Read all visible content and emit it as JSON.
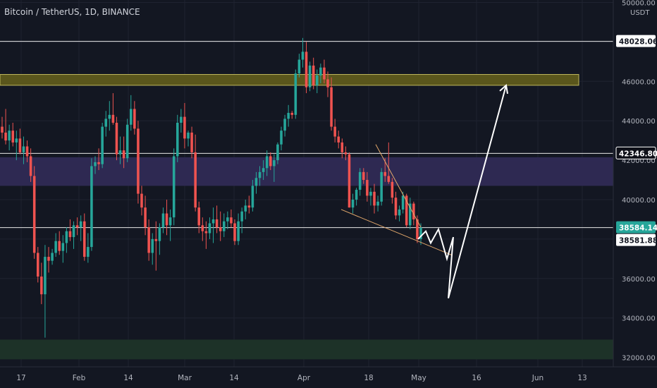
{
  "header": {
    "title": "Bitcoin / TetherUS, 1D, BINANCE",
    "currency": "USDT"
  },
  "chart_data": {
    "type": "candlestick",
    "title": "Bitcoin / TetherUS, 1D, BINANCE",
    "y_ticks": [
      "50000.00",
      "46000.00",
      "44000.00",
      "42000.00",
      "40000.00",
      "36000.00",
      "34000.00",
      "32000.00"
    ],
    "x_ticks": [
      "17",
      "Feb",
      "14",
      "Mar",
      "14",
      "Apr",
      "18",
      "May",
      "16",
      "Jun",
      "13"
    ],
    "ylim": [
      31500,
      50200
    ],
    "price_labels": [
      {
        "text": "48028.06",
        "value": 48028.06,
        "style": "line"
      },
      {
        "text": "42346.80",
        "value": 42346.8,
        "style": "dark"
      },
      {
        "text": "38584.14",
        "value": 38584.14,
        "style": "green"
      },
      {
        "text": "38581.88",
        "value": 38581.88,
        "style": "line"
      }
    ],
    "horizontal_lines": [
      48028.06,
      42346.8,
      38584.14
    ],
    "zones": [
      {
        "name": "resistance",
        "from": 45800,
        "to": 46350,
        "color": "#5e5a1c"
      },
      {
        "name": "range",
        "from": 40700,
        "to": 42150,
        "color": "#2f2a55"
      },
      {
        "name": "support",
        "from": 31900,
        "to": 32900,
        "color": "#1e3429"
      }
    ],
    "colors": {
      "up": "#26a69a",
      "down": "#ef5350",
      "background": "#131722",
      "grid": "#1f2330"
    },
    "candles_note": "OHLC values estimated from the visible candles",
    "candles": [
      [
        43700,
        44200,
        43100,
        43400
      ],
      [
        43400,
        44600,
        42800,
        43000
      ],
      [
        43000,
        43800,
        42500,
        43500
      ],
      [
        43500,
        43900,
        42700,
        42900
      ],
      [
        42900,
        43500,
        42000,
        43100
      ],
      [
        43100,
        43600,
        42300,
        42400
      ],
      [
        42400,
        43200,
        41800,
        42700
      ],
      [
        42700,
        43000,
        41900,
        42200
      ],
      [
        42200,
        42600,
        40900,
        41200
      ],
      [
        41200,
        41700,
        37000,
        37300
      ],
      [
        37300,
        37600,
        35800,
        36100
      ],
      [
        36100,
        36800,
        34700,
        35200
      ],
      [
        35200,
        37700,
        33000,
        37100
      ],
      [
        37100,
        37600,
        36300,
        36900
      ],
      [
        36900,
        37500,
        36700,
        37300
      ],
      [
        37300,
        38300,
        37100,
        37900
      ],
      [
        37900,
        38400,
        37200,
        37400
      ],
      [
        37400,
        38200,
        36800,
        37800
      ],
      [
        37800,
        38600,
        37300,
        38400
      ],
      [
        38400,
        39000,
        37900,
        38100
      ],
      [
        38100,
        38900,
        37500,
        38700
      ],
      [
        38700,
        39100,
        38200,
        38600
      ],
      [
        38600,
        39200,
        37900,
        38900
      ],
      [
        38900,
        39300,
        36900,
        37100
      ],
      [
        37100,
        38300,
        36800,
        37600
      ],
      [
        37600,
        42100,
        37400,
        41700
      ],
      [
        41700,
        42200,
        41300,
        41900
      ],
      [
        41900,
        42600,
        41500,
        41800
      ],
      [
        41800,
        43900,
        41600,
        43700
      ],
      [
        43700,
        44500,
        43200,
        44100
      ],
      [
        44100,
        45000,
        43500,
        44300
      ],
      [
        44300,
        45400,
        43800,
        43900
      ],
      [
        43900,
        44200,
        42000,
        42300
      ],
      [
        42300,
        43200,
        41800,
        42500
      ],
      [
        42500,
        43200,
        41600,
        42100
      ],
      [
        42100,
        44100,
        41900,
        43800
      ],
      [
        43800,
        45300,
        43500,
        44600
      ],
      [
        44600,
        45000,
        43300,
        43600
      ],
      [
        43600,
        44000,
        39800,
        40300
      ],
      [
        40300,
        40700,
        39200,
        39600
      ],
      [
        39600,
        40200,
        38200,
        38600
      ],
      [
        38600,
        39000,
        36900,
        37300
      ],
      [
        37300,
        38300,
        36700,
        38000
      ],
      [
        38000,
        38900,
        36400,
        37900
      ],
      [
        37900,
        38800,
        37200,
        38600
      ],
      [
        38600,
        39600,
        38300,
        39300
      ],
      [
        39300,
        40000,
        38200,
        38700
      ],
      [
        38700,
        39500,
        37900,
        39100
      ],
      [
        39100,
        42600,
        38700,
        42200
      ],
      [
        42200,
        44300,
        41900,
        43900
      ],
      [
        43900,
        44600,
        43400,
        44200
      ],
      [
        44200,
        44900,
        42600,
        43100
      ],
      [
        43100,
        43500,
        42700,
        43400
      ],
      [
        43400,
        43700,
        42100,
        42400
      ],
      [
        42400,
        43300,
        39400,
        39600
      ],
      [
        39600,
        39900,
        38300,
        38700
      ],
      [
        38700,
        39100,
        37900,
        38400
      ],
      [
        38400,
        38900,
        37500,
        38300
      ],
      [
        38300,
        39100,
        38000,
        38800
      ],
      [
        38800,
        39600,
        37800,
        39000
      ],
      [
        39000,
        39700,
        38300,
        38600
      ],
      [
        38600,
        39400,
        37900,
        38400
      ],
      [
        38400,
        39300,
        38100,
        38900
      ],
      [
        38900,
        39400,
        38500,
        39100
      ],
      [
        39100,
        39500,
        38600,
        38800
      ],
      [
        38800,
        39000,
        37700,
        37900
      ],
      [
        37900,
        39300,
        37700,
        38900
      ],
      [
        38900,
        39600,
        38300,
        39400
      ],
      [
        39400,
        40000,
        39000,
        39700
      ],
      [
        39700,
        40200,
        39300,
        39600
      ],
      [
        39600,
        41000,
        39400,
        40700
      ],
      [
        40700,
        41400,
        40300,
        41100
      ],
      [
        41100,
        41700,
        40700,
        41400
      ],
      [
        41400,
        42000,
        41000,
        41600
      ],
      [
        41600,
        42500,
        41200,
        42200
      ],
      [
        42200,
        42400,
        41500,
        41700
      ],
      [
        41700,
        42300,
        40900,
        42000
      ],
      [
        42000,
        42900,
        41800,
        42800
      ],
      [
        42800,
        43700,
        42500,
        43500
      ],
      [
        43500,
        44300,
        43200,
        44100
      ],
      [
        44100,
        44800,
        43700,
        44400
      ],
      [
        44400,
        44500,
        44100,
        44300
      ],
      [
        44300,
        46600,
        44100,
        46400
      ],
      [
        46400,
        47400,
        46200,
        47100
      ],
      [
        47100,
        48200,
        46700,
        47500
      ],
      [
        47500,
        48000,
        45400,
        45700
      ],
      [
        45700,
        47000,
        45500,
        46800
      ],
      [
        46800,
        47200,
        45600,
        45800
      ],
      [
        45800,
        46600,
        45400,
        46300
      ],
      [
        46300,
        46900,
        45900,
        46700
      ],
      [
        46700,
        47100,
        45900,
        46100
      ],
      [
        46100,
        46500,
        45200,
        45700
      ],
      [
        45700,
        46200,
        43500,
        43700
      ],
      [
        43700,
        44100,
        42900,
        43200
      ],
      [
        43200,
        43500,
        42600,
        42900
      ],
      [
        42900,
        43100,
        42100,
        42400
      ],
      [
        42400,
        42700,
        42000,
        42300
      ],
      [
        42300,
        42400,
        39600,
        39600
      ],
      [
        39600,
        40300,
        39300,
        40000
      ],
      [
        40000,
        40600,
        39700,
        40500
      ],
      [
        40500,
        41600,
        40200,
        41400
      ],
      [
        41400,
        41600,
        40800,
        41000
      ],
      [
        41000,
        41400,
        39900,
        40200
      ],
      [
        40200,
        40600,
        39700,
        40400
      ],
      [
        40400,
        40800,
        39300,
        39700
      ],
      [
        39700,
        40200,
        39400,
        39900
      ],
      [
        39900,
        41600,
        39700,
        41400
      ],
      [
        41400,
        42100,
        40900,
        41200
      ],
      [
        41200,
        42900,
        40800,
        40900
      ],
      [
        40900,
        41100,
        39800,
        40100
      ],
      [
        40100,
        40400,
        39000,
        39200
      ],
      [
        39200,
        39700,
        38900,
        39500
      ],
      [
        39500,
        40400,
        39300,
        40200
      ],
      [
        40200,
        40300,
        38600,
        38700
      ],
      [
        38700,
        40100,
        38500,
        39800
      ],
      [
        39800,
        39900,
        38700,
        39000
      ],
      [
        39000,
        39200,
        37800,
        38000
      ],
      [
        38000,
        38800,
        37700,
        38584.14
      ]
    ],
    "annotations": {
      "wedge_upper": [
        [
          38900,
          42800
        ],
        [
          39300,
          38600
        ]
      ],
      "wedge_lower": [
        [
          38600,
          39500
        ],
        [
          39500,
          37200
        ]
      ],
      "projection_path": [
        38000,
        38400,
        37800,
        38500,
        37000,
        38100,
        35000,
        45800
      ],
      "projection_arrow_target": 45800
    }
  }
}
